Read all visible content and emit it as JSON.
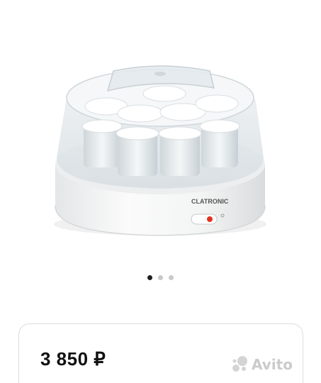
{
  "product": {
    "brand_label": "CLATRONIC",
    "image_icon": "yogurt-maker-image"
  },
  "gallery": {
    "total": 3,
    "active_index": 0
  },
  "listing": {
    "price": "3 850 ₽"
  },
  "watermark": {
    "text": "Avito",
    "icon": "avito-logo-icon"
  }
}
